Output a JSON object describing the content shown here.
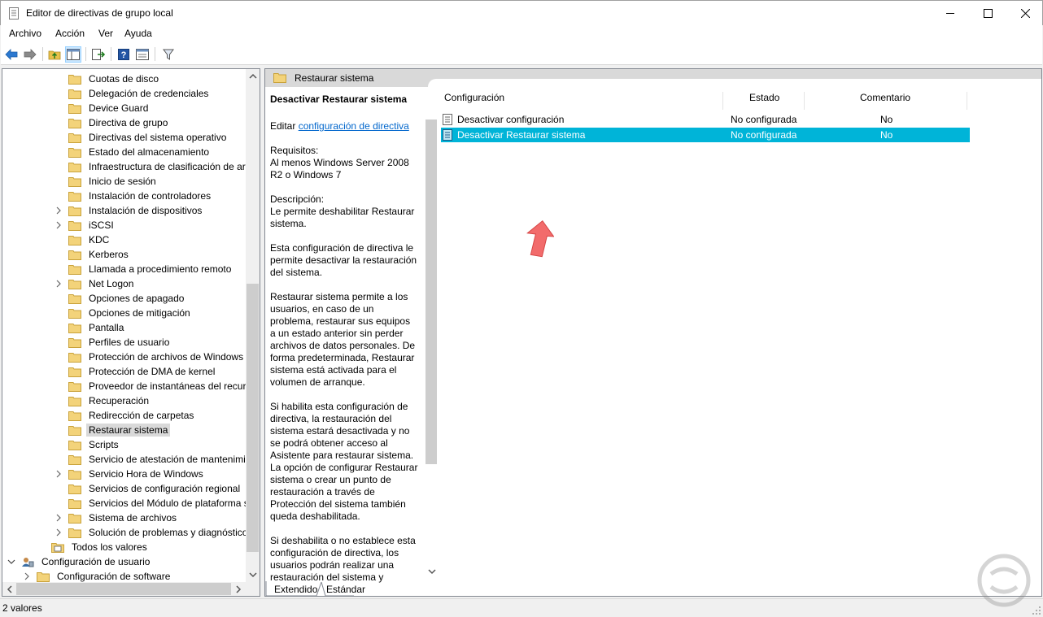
{
  "window": {
    "title": "Editor de directivas de grupo local",
    "accent": "#00b4d8"
  },
  "menu": [
    "Archivo",
    "Acción",
    "Ver",
    "Ayuda"
  ],
  "toolbar": {
    "icons": [
      "back-arrow-icon",
      "forward-arrow-icon",
      "up-folder-icon",
      "show-hide-tree-icon",
      "export-list-icon",
      "help-icon",
      "properties-icon",
      "filter-icon"
    ]
  },
  "tree": {
    "items": [
      {
        "label": "Cuotas de disco",
        "expandable": false
      },
      {
        "label": "Delegación de credenciales",
        "expandable": false
      },
      {
        "label": "Device Guard",
        "expandable": false
      },
      {
        "label": "Directiva de grupo",
        "expandable": false
      },
      {
        "label": "Directivas del sistema operativo",
        "expandable": false
      },
      {
        "label": "Estado del almacenamiento",
        "expandable": false
      },
      {
        "label": "Infraestructura de clasificación de arch",
        "expandable": false
      },
      {
        "label": "Inicio de sesión",
        "expandable": false
      },
      {
        "label": "Instalación de controladores",
        "expandable": false
      },
      {
        "label": "Instalación de dispositivos",
        "expandable": true
      },
      {
        "label": "iSCSI",
        "expandable": true
      },
      {
        "label": "KDC",
        "expandable": false
      },
      {
        "label": "Kerberos",
        "expandable": false
      },
      {
        "label": "Llamada a procedimiento remoto",
        "expandable": false
      },
      {
        "label": "Net Logon",
        "expandable": true
      },
      {
        "label": "Opciones de apagado",
        "expandable": false
      },
      {
        "label": "Opciones de mitigación",
        "expandable": false
      },
      {
        "label": "Pantalla",
        "expandable": false
      },
      {
        "label": "Perfiles de usuario",
        "expandable": false
      },
      {
        "label": "Protección de archivos de Windows",
        "expandable": false
      },
      {
        "label": "Protección de DMA de kernel",
        "expandable": false
      },
      {
        "label": "Proveedor de instantáneas del recurso",
        "expandable": false
      },
      {
        "label": "Recuperación",
        "expandable": false
      },
      {
        "label": "Redirección de carpetas",
        "expandable": false
      },
      {
        "label": "Restaurar sistema",
        "expandable": false,
        "selected": true
      },
      {
        "label": "Scripts",
        "expandable": false
      },
      {
        "label": "Servicio de atestación de mantenimien",
        "expandable": false
      },
      {
        "label": "Servicio Hora de Windows",
        "expandable": true
      },
      {
        "label": "Servicios de configuración regional",
        "expandable": false
      },
      {
        "label": "Servicios del Módulo de plataforma se",
        "expandable": false
      },
      {
        "label": "Sistema de archivos",
        "expandable": true
      },
      {
        "label": "Solución de problemas y diagnósticos",
        "expandable": true
      }
    ],
    "all_values": "Todos los valores",
    "user_config": "Configuración de usuario",
    "software_config": "Configuración de software"
  },
  "right": {
    "header": "Restaurar sistema",
    "desc_title": "Desactivar Restaurar sistema",
    "edit_prefix": "Editar",
    "edit_link": "configuración de directiva",
    "req_label": "Requisitos:",
    "req_text": "Al menos Windows Server 2008 R2 o Windows 7",
    "desc_label": "Descripción:",
    "desc_1": "Le permite deshabilitar Restaurar sistema.",
    "desc_2": "Esta configuración de directiva le permite desactivar la restauración del sistema.",
    "desc_3": "Restaurar sistema permite a los usuarios, en caso de un problema, restaurar sus equipos a un estado anterior sin perder archivos de datos personales. De forma predeterminada, Restaurar sistema está activada para el volumen de arranque.",
    "desc_4": "Si habilita esta configuración de directiva, la restauración del sistema estará desactivada y no se podrá obtener acceso al Asistente para restaurar sistema. La opción de configurar Restaurar sistema o crear un punto de restauración a través de Protección del sistema también queda deshabilitada.",
    "desc_5": "Si deshabilita o no establece esta configuración de directiva, los usuarios podrán realizar una restauración del sistema y configurar Restaurar sistema a",
    "columns": [
      "Configuración",
      "Estado",
      "Comentario"
    ],
    "rows": [
      {
        "name": "Desactivar configuración",
        "state": "No configurada",
        "comment": "No"
      },
      {
        "name": "Desactivar Restaurar sistema",
        "state": "No configurada",
        "comment": "No"
      }
    ],
    "tabs": [
      "Extendido",
      "Estándar"
    ]
  },
  "status": "2 valores"
}
